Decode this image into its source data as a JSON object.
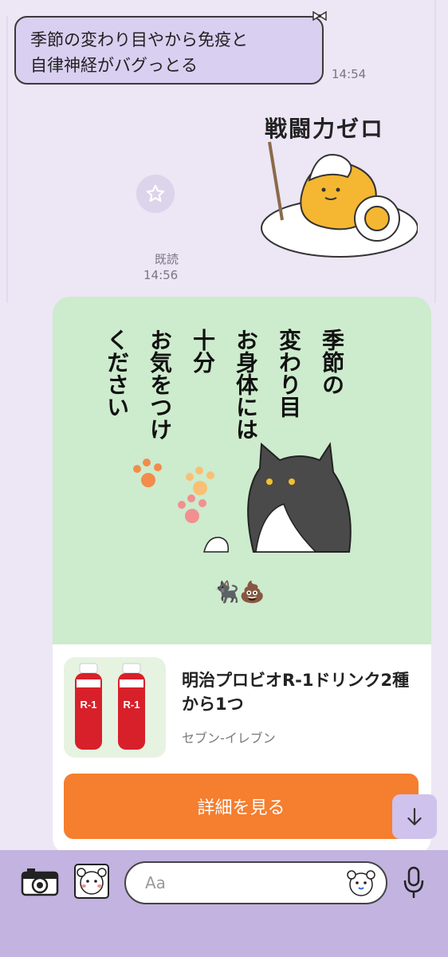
{
  "chat": {
    "incoming_text_line1": "季節の変わり目やから免疫と",
    "incoming_text_line2": "自律神経がバグっとる",
    "incoming_time": "14:54",
    "sticker_caption": "戦闘力ゼロ",
    "read_label": "既読",
    "outgoing_time": "14:56"
  },
  "card": {
    "image_text_col1": "季節の",
    "image_text_col2": "変わり目",
    "image_text_col3": "お身体には",
    "image_text_col4": "十分",
    "image_text_col5": "お気をつけ",
    "image_text_col6": "ください",
    "emoji_line": "🐈‍⬛💩",
    "product_title": "明治プロビオR-1ドリンク2種から1つ",
    "product_store": "セブン-イレブン",
    "detail_button": "詳細を見る",
    "bottle_label": "R-1"
  },
  "composer": {
    "placeholder": "Aa"
  },
  "icons": {
    "star": "star-icon",
    "scroll_down": "arrow-down-icon",
    "camera": "camera-icon",
    "sticker": "sticker-icon",
    "emoji": "emoji-icon",
    "mic": "microphone-icon"
  },
  "colors": {
    "background": "#ECE6F5",
    "bubble": "#D9CFF0",
    "button": "#F57E2F",
    "bar": "#C2B3E0"
  }
}
